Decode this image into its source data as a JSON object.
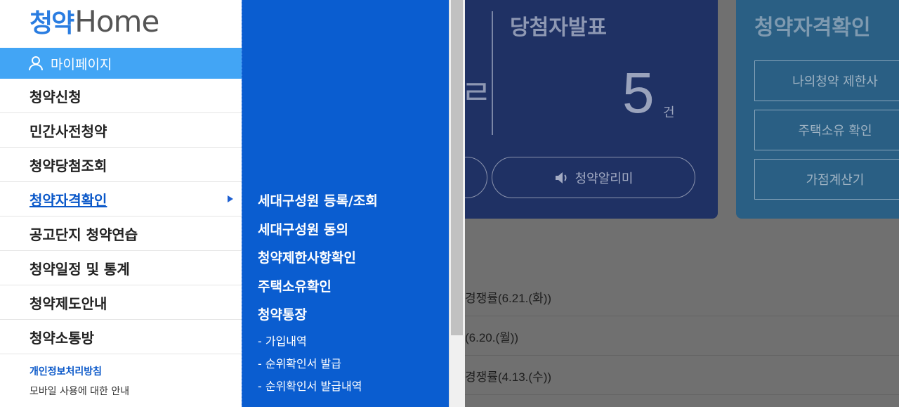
{
  "logo": {
    "kr": "청약",
    "en": "Home"
  },
  "sidebar": {
    "mypage": "마이페이지",
    "items": [
      {
        "label": "청약신청"
      },
      {
        "label": "민간사전청약"
      },
      {
        "label": "청약당첨조회"
      },
      {
        "label": "청약자격확인"
      },
      {
        "label": "공고단지 청약연습"
      },
      {
        "label": "청약일정 및 통계"
      },
      {
        "label": "청약제도안내"
      },
      {
        "label": "청약소통방"
      }
    ],
    "footer": {
      "privacy": "개인정보처리방침",
      "mobile": "모바일 사용에 대한 안내"
    }
  },
  "submenu": {
    "items": [
      "세대구성원 등록/조회",
      "세대구성원 동의",
      "청약제한사항확인",
      "주택소유확인",
      "청약통장"
    ],
    "children": [
      "- 가입내역",
      "- 순위확인서 발급",
      "- 순위확인서 발급내역"
    ]
  },
  "main": {
    "winner": {
      "title": "당첨자발표",
      "count": "5",
      "unit": "건"
    },
    "alarm_label": "청약알리미",
    "qualification": {
      "title": "청약자격확인",
      "buttons": [
        "나의청약 제한사",
        "주택소유 확인",
        "가점계산기"
      ]
    },
    "notices": [
      "경쟁률(6.21.(화))",
      "(6.20.(월))",
      "경쟁률(4.13.(수))"
    ]
  },
  "colors": {
    "accent": "#42a5f5",
    "submenu_bg": "#0a5dd0",
    "active_link": "#0a58c9"
  }
}
